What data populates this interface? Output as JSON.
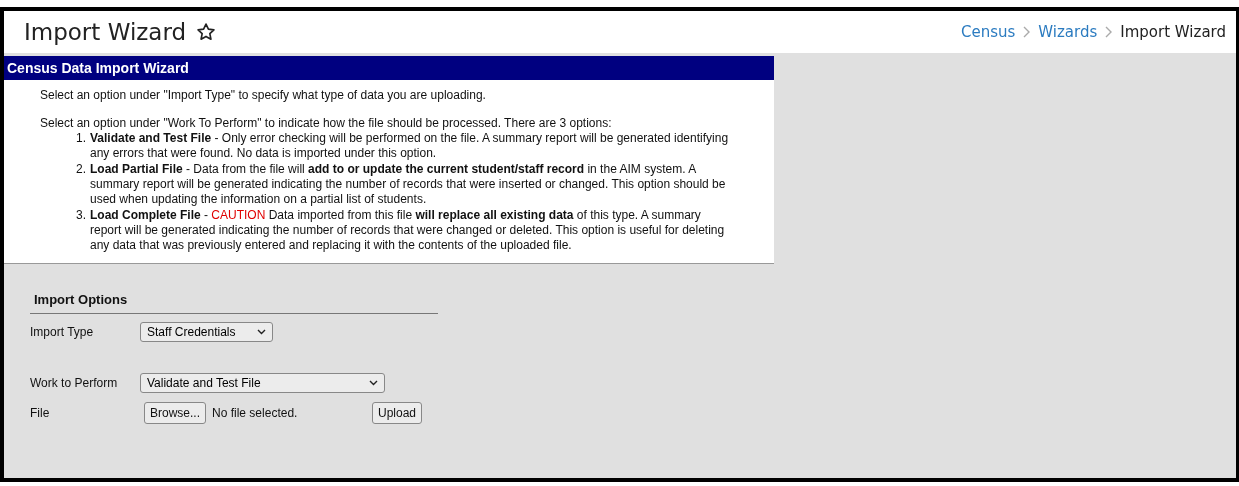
{
  "header": {
    "title": "Import Wizard",
    "breadcrumbs": [
      {
        "label": "Census",
        "kind": "link"
      },
      {
        "label": "Wizards",
        "kind": "link"
      },
      {
        "label": "Import Wizard",
        "kind": "current"
      }
    ]
  },
  "panel": {
    "title": "Census Data Import Wizard",
    "intro": [
      "Select an option under \"Import Type\" to specify what type of data you are uploading.",
      "Select an option under \"Work To Perform\" to indicate how the file should be processed. There are 3 options:"
    ],
    "options": [
      {
        "number": "1.",
        "segments": [
          {
            "kind": "bold",
            "text": "Validate and Test File"
          },
          {
            "kind": "plain",
            "text": " - Only error checking will be performed on the file. A summary report will be generated identifying any errors that were found. No data is imported under this option."
          }
        ]
      },
      {
        "number": "2.",
        "segments": [
          {
            "kind": "bold",
            "text": "Load Partial File"
          },
          {
            "kind": "plain",
            "text": " - Data from the file will "
          },
          {
            "kind": "bold",
            "text": "add to or update the current student/staff record"
          },
          {
            "kind": "plain",
            "text": " in the AIM system. A summary report will be generated indicating the number of records that were inserted or changed. This option should be used when updating the information on a partial list of students."
          }
        ]
      },
      {
        "number": "3.",
        "segments": [
          {
            "kind": "bold",
            "text": "Load Complete File"
          },
          {
            "kind": "plain",
            "text": " - "
          },
          {
            "kind": "caution",
            "text": "CAUTION"
          },
          {
            "kind": "plain",
            "text": " Data imported from this file "
          },
          {
            "kind": "bold",
            "text": "will replace all existing data"
          },
          {
            "kind": "plain",
            "text": " of this type. A summary report will be generated indicating the number of records that were changed or deleted. This option is useful for deleting any data that was previously entered and replacing it with the contents of the uploaded file."
          }
        ]
      }
    ]
  },
  "import_options": {
    "title": "Import Options",
    "import_type": {
      "label": "Import Type",
      "value": "Staff Credentials"
    },
    "work_to_perform": {
      "label": "Work to Perform",
      "value": "Validate and Test File"
    },
    "file": {
      "label": "File",
      "browse": "Browse...",
      "status": "No file selected.",
      "upload": "Upload"
    }
  }
}
